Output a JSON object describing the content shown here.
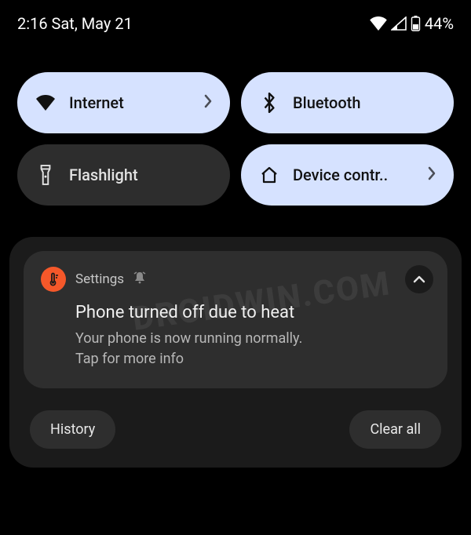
{
  "status": {
    "time_date": "2:16 Sat, May 21",
    "battery_pct": "44%"
  },
  "quick_settings": {
    "internet": {
      "label": "Internet"
    },
    "bluetooth": {
      "label": "Bluetooth"
    },
    "flashlight": {
      "label": "Flashlight"
    },
    "device_controls": {
      "label": "Device contr.."
    }
  },
  "notification": {
    "app_name": "Settings",
    "title": "Phone turned off due to heat",
    "body_line1": "Your phone is now running normally.",
    "body_line2": "Tap for more info"
  },
  "shade_actions": {
    "history": "History",
    "clear_all": "Clear all"
  },
  "watermark": "DROIDWIN.COM"
}
